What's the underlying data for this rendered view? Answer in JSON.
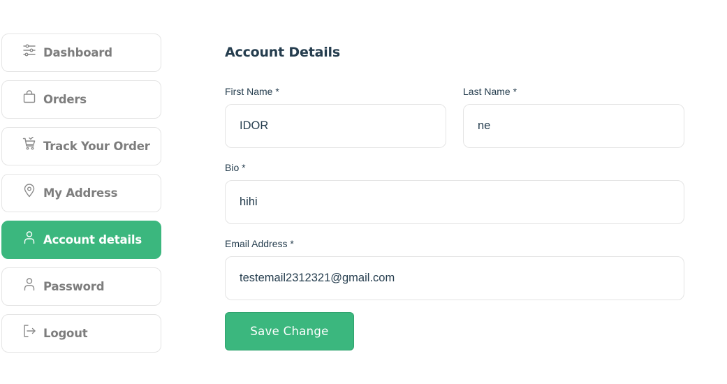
{
  "sidebar": {
    "items": [
      {
        "label": "Dashboard",
        "icon": "sliders-icon",
        "active": false
      },
      {
        "label": "Orders",
        "icon": "shopping-bag-icon",
        "active": false
      },
      {
        "label": "Track Your Order",
        "icon": "cart-check-icon",
        "active": false
      },
      {
        "label": "My Address",
        "icon": "map-pin-icon",
        "active": false
      },
      {
        "label": "Account details",
        "icon": "user-icon",
        "active": true
      },
      {
        "label": "Password",
        "icon": "user-icon",
        "active": false
      },
      {
        "label": "Logout",
        "icon": "logout-icon",
        "active": false
      }
    ]
  },
  "main": {
    "title": "Account Details",
    "first_name": {
      "label": "First Name *",
      "value": "IDOR"
    },
    "last_name": {
      "label": "Last Name *",
      "value": "ne"
    },
    "bio": {
      "label": "Bio *",
      "value": "hihi"
    },
    "email": {
      "label": "Email Address *",
      "value": "testemail2312321@gmail.com"
    },
    "save_label": "Save Change"
  },
  "colors": {
    "accent": "#3bb77e",
    "heading": "#253d4e",
    "muted_text": "#7d7d7d",
    "border": "#e4e4e4"
  }
}
